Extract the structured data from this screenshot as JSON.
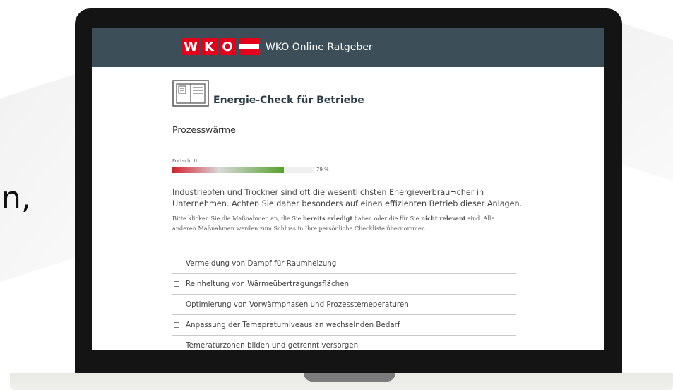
{
  "side_fragment": "n,",
  "header": {
    "logo_letters": [
      "W",
      "K",
      "O"
    ],
    "title": "WKO Online Ratgeber"
  },
  "page": {
    "title": "Energie-Check für Betriebe",
    "section": "Prozesswärme",
    "progress": {
      "label": "Fortschritt",
      "value_text": "79 %",
      "value": 79
    },
    "intro": "Industrieöfen und Trockner sind oft die wesentlichsten Energieverbrau¬cher in Unternehmen. Achten Sie daher besonders auf einen effizienten Betrieb dieser Anlagen.",
    "note": {
      "part1": "Bitte klicken Sie die Maßnahmen an, die Sie ",
      "bold1": "bereits erledigt",
      "part2": " haben oder die für Sie ",
      "bold2": "nicht relevant",
      "part3": " sind. Alle anderen Maßnahmen werden zum Schluss in Ihre persönliche Checkliste übernommen."
    },
    "measures": [
      "Vermeidung von Dampf für Raumheizung",
      "Reinheltung von Wärmeübertragungsflächen",
      "Optimierung von Vorwärmphasen und Prozesstemeperaturen",
      "Anpassung der Temepraturniveaus an wechselnden Bedarf",
      "Temeraturzonen bilden und getrennt versorgen"
    ]
  },
  "colors": {
    "header_bg": "#3c4f59",
    "logo_red": "#e2001a",
    "progress_start": "#d0202e",
    "progress_end": "#55a22c"
  }
}
